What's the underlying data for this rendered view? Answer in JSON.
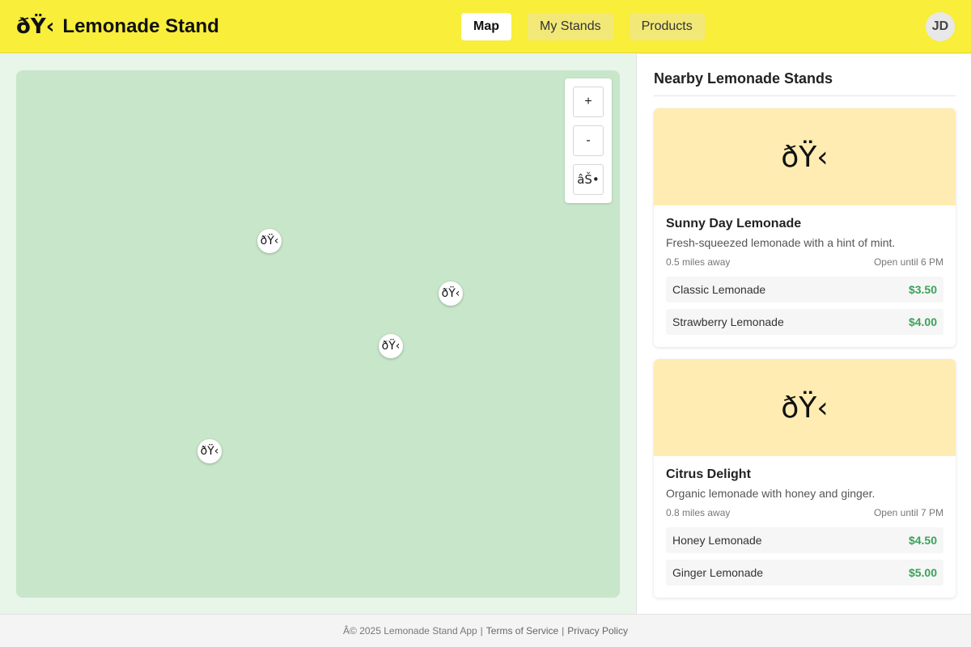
{
  "header": {
    "logo_glyph": "ðŸ‹",
    "title": "Lemonade Stand",
    "nav": [
      {
        "label": "Map",
        "active": true
      },
      {
        "label": "My Stands",
        "active": false
      },
      {
        "label": "Products",
        "active": false
      }
    ],
    "avatar_initials": "JD"
  },
  "map": {
    "controls": {
      "zoom_in": "+",
      "zoom_out": "-",
      "locate": "âŠ•"
    },
    "markers": [
      {
        "glyph": "ðŸ‹"
      },
      {
        "glyph": "ðŸ‹"
      },
      {
        "glyph": "ðŸ‹"
      },
      {
        "glyph": "ðŸ‹"
      }
    ]
  },
  "sidebar": {
    "title": "Nearby Lemonade Stands",
    "stands": [
      {
        "image_glyph": "ðŸ‹",
        "name": "Sunny Day Lemonade",
        "description": "Fresh-squeezed lemonade with a hint of mint.",
        "distance": "0.5 miles away",
        "hours": "Open until 6 PM",
        "items": [
          {
            "name": "Classic Lemonade",
            "price": "$3.50"
          },
          {
            "name": "Strawberry Lemonade",
            "price": "$4.00"
          }
        ]
      },
      {
        "image_glyph": "ðŸ‹",
        "name": "Citrus Delight",
        "description": "Organic lemonade with honey and ginger.",
        "distance": "0.8 miles away",
        "hours": "Open until 7 PM",
        "items": [
          {
            "name": "Honey Lemonade",
            "price": "$4.50"
          },
          {
            "name": "Ginger Lemonade",
            "price": "$5.00"
          }
        ]
      }
    ]
  },
  "footer": {
    "copyright": "Â© 2025 Lemonade Stand App",
    "separator": "|",
    "terms": "Terms of Service",
    "privacy": "Privacy Policy"
  },
  "colors": {
    "header_bg": "#f9ee3a",
    "map_bg": "#c8e6c9",
    "card_image_bg": "#ffecb3",
    "price": "#3aa35a"
  }
}
